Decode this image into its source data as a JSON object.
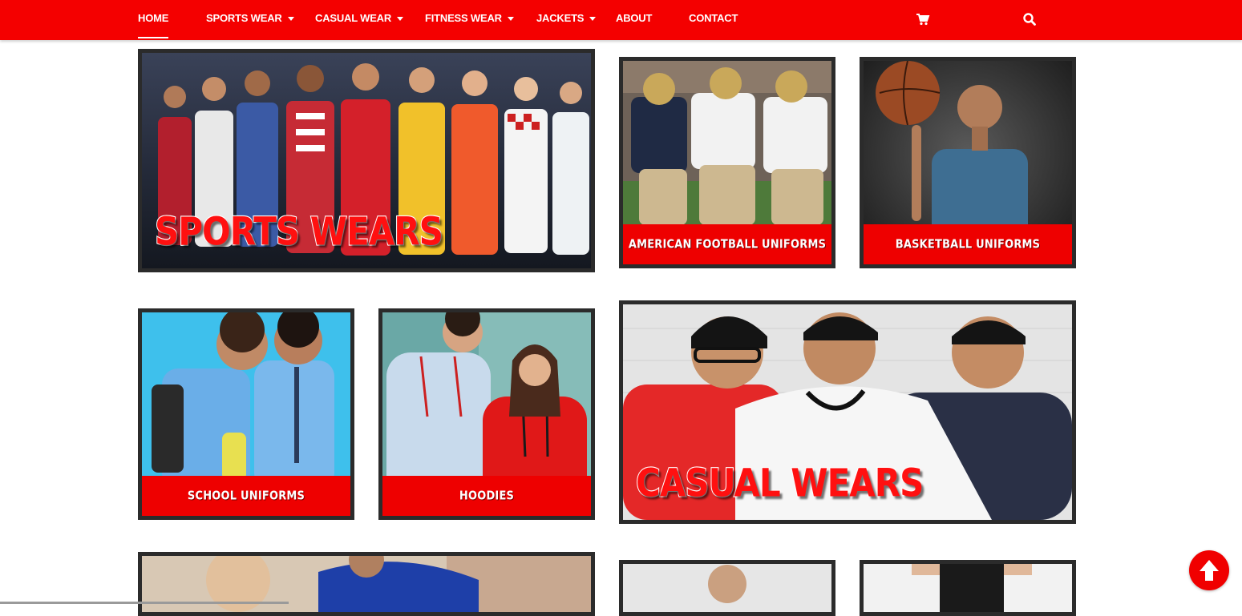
{
  "nav": {
    "items": [
      {
        "label": "HOME",
        "active": true,
        "dropdown": false
      },
      {
        "label": "SPORTS WEAR",
        "active": false,
        "dropdown": true
      },
      {
        "label": "CASUAL WEAR",
        "active": false,
        "dropdown": true
      },
      {
        "label": "FITNESS WEAR",
        "active": false,
        "dropdown": true
      },
      {
        "label": "JACKETS",
        "active": false,
        "dropdown": true
      },
      {
        "label": "ABOUT",
        "active": false,
        "dropdown": false
      },
      {
        "label": "CONTACT",
        "active": false,
        "dropdown": false
      }
    ],
    "icons": [
      "cart-icon",
      "search-icon"
    ]
  },
  "tiles": {
    "sports_wears": "SPORTS WEARS",
    "american_football": "AMERICAN FOOTBALL UNIFORMS",
    "basketball": "BASKETBALL UNIFORMS",
    "school_uniforms": "SCHOOL UNIFORMS",
    "hoodies": "HOODIES",
    "casual_wears": "CASUAL WEARS"
  },
  "colors": {
    "brand_red": "#f40000",
    "tile_border": "#2b2b2b",
    "label_band": "#ee0000"
  },
  "scroll_top": {
    "icon": "arrow-up-icon"
  }
}
